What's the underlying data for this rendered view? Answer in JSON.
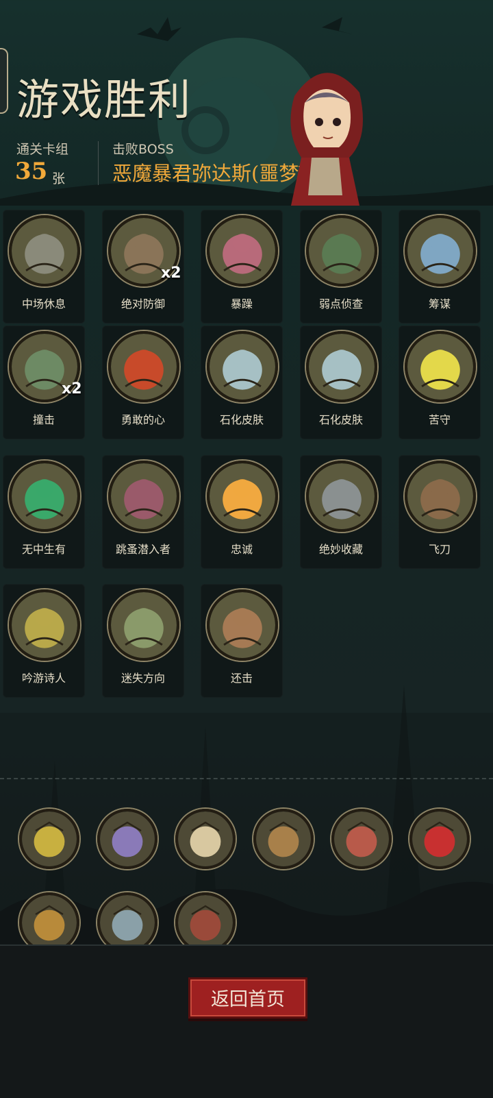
{
  "header": {
    "title": "游戏胜利",
    "deck_label": "通关卡组",
    "deck_count": "35",
    "deck_unit": "张",
    "boss_label": "击败BOSS",
    "boss_name": "恶魔暴君弥达斯(噩梦V)"
  },
  "cards": [
    {
      "name": "中场休息",
      "multiplier": "",
      "icon": "hooded-figure-icon",
      "tint": "#8a8a7a"
    },
    {
      "name": "绝对防御",
      "multiplier": "x2",
      "icon": "shield-warrior-icon",
      "tint": "#8a7458"
    },
    {
      "name": "暴躁",
      "multiplier": "",
      "icon": "angry-ogre-icon",
      "tint": "#b86a7a"
    },
    {
      "name": "弱点侦查",
      "multiplier": "",
      "icon": "wolf-icon",
      "tint": "#5a7a52"
    },
    {
      "name": "筹谋",
      "multiplier": "",
      "icon": "map-flags-icon",
      "tint": "#7fa6c2"
    },
    {
      "name": "撞击",
      "multiplier": "x2",
      "icon": "boar-icon",
      "tint": "#6d8a64"
    },
    {
      "name": "勇敢的心",
      "multiplier": "",
      "icon": "heart-warrior-icon",
      "tint": "#c84a2a"
    },
    {
      "name": "石化皮肤",
      "multiplier": "",
      "icon": "stone-fist-icon",
      "tint": "#a6c0c4"
    },
    {
      "name": "石化皮肤",
      "multiplier": "",
      "icon": "stone-fist-icon",
      "tint": "#a6c0c4"
    },
    {
      "name": "苦守",
      "multiplier": "",
      "icon": "shield-burst-icon",
      "tint": "#e3d84a"
    },
    {
      "name": "无中生有",
      "multiplier": "",
      "icon": "green-creature-icon",
      "tint": "#3aa86a"
    },
    {
      "name": "跳蚤潜入者",
      "multiplier": "",
      "icon": "flea-thief-icon",
      "tint": "#9a5a6a"
    },
    {
      "name": "忠诚",
      "multiplier": "",
      "icon": "cross-icon",
      "tint": "#f0a840"
    },
    {
      "name": "绝妙收藏",
      "multiplier": "",
      "icon": "treasure-shield-icon",
      "tint": "#8a9090"
    },
    {
      "name": "飞刀",
      "multiplier": "",
      "icon": "throwing-knives-icon",
      "tint": "#8a6a4a"
    },
    {
      "name": "吟游诗人",
      "multiplier": "",
      "icon": "bard-icon",
      "tint": "#b8a84a"
    },
    {
      "name": "迷失方向",
      "multiplier": "",
      "icon": "lost-path-icon",
      "tint": "#8a9a6a"
    },
    {
      "name": "还击",
      "multiplier": "",
      "icon": "pirate-counter-icon",
      "tint": "#a67a54"
    }
  ],
  "relics": [
    {
      "icon": "lightning-beast-icon",
      "tint": "#c8b040"
    },
    {
      "icon": "purple-tentacle-icon",
      "tint": "#8a7ab8"
    },
    {
      "icon": "eagle-icon",
      "tint": "#d8c8a0"
    },
    {
      "icon": "deer-icon",
      "tint": "#a8804a"
    },
    {
      "icon": "bloody-hand-icon",
      "tint": "#b85a4a"
    },
    {
      "icon": "red-banner-icon",
      "tint": "#c83030"
    },
    {
      "icon": "fire-claw-icon",
      "tint": "#b88a3a"
    },
    {
      "icon": "owl-icon",
      "tint": "#8aa0a8"
    },
    {
      "icon": "red-hood-girl-icon",
      "tint": "#9a4a3a"
    }
  ],
  "footer": {
    "return_label": "返回首页"
  }
}
